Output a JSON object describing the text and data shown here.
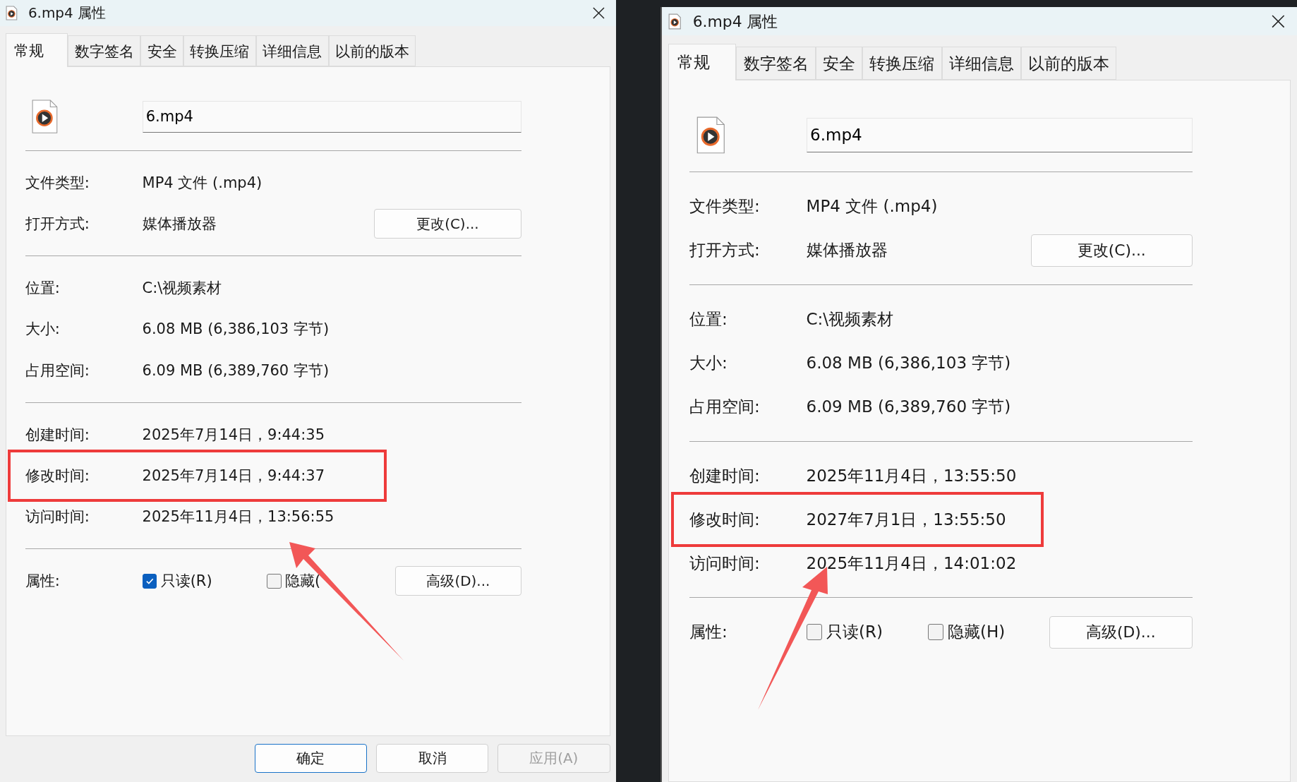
{
  "dialogs": [
    {
      "title": "6.mp4 属性",
      "tabs": [
        {
          "label": "常规",
          "selected": true
        },
        {
          "label": "数字签名",
          "selected": false
        },
        {
          "label": "安全",
          "selected": false
        },
        {
          "label": "转换压缩",
          "selected": false
        },
        {
          "label": "详细信息",
          "selected": false
        },
        {
          "label": "以前的版本",
          "selected": false
        }
      ],
      "filename": "6.mp4",
      "groups": [
        [
          {
            "label": "文件类型:",
            "value": "MP4 文件 (.mp4)",
            "highlighted": false
          },
          {
            "label": "打开方式:",
            "value": "媒体播放器",
            "button": "更改(C)...",
            "highlighted": false
          }
        ],
        [
          {
            "label": "位置:",
            "value": "C:\\视频素材",
            "highlighted": false
          },
          {
            "label": "大小:",
            "value": "6.08 MB (6,386,103 字节)",
            "highlighted": false
          },
          {
            "label": "占用空间:",
            "value": "6.09 MB (6,389,760 字节)",
            "highlighted": false
          }
        ],
        [
          {
            "label": "创建时间:",
            "value": "2025年7月14日，9:44:35",
            "highlighted": false
          },
          {
            "label": "修改时间:",
            "value": "2025年7月14日，9:44:37",
            "highlighted": true
          },
          {
            "label": "访问时间:",
            "value": "2025年11月4日，13:56:55",
            "highlighted": false
          }
        ]
      ],
      "attributes": {
        "label": "属性:",
        "checkboxes": [
          {
            "label": "只读(R)",
            "checked": true
          },
          {
            "label": "隐藏(",
            "checked": false
          }
        ],
        "button": "高级(D)..."
      },
      "footer": [
        {
          "label": "确定",
          "disabled": false
        },
        {
          "label": "取消",
          "disabled": false
        },
        {
          "label": "应用(A)",
          "disabled": true
        }
      ]
    },
    {
      "title": "6.mp4 属性",
      "tabs": [
        {
          "label": "常规",
          "selected": true
        },
        {
          "label": "数字签名",
          "selected": false
        },
        {
          "label": "安全",
          "selected": false
        },
        {
          "label": "转换压缩",
          "selected": false
        },
        {
          "label": "详细信息",
          "selected": false
        },
        {
          "label": "以前的版本",
          "selected": false
        }
      ],
      "filename": "6.mp4",
      "groups": [
        [
          {
            "label": "文件类型:",
            "value": "MP4 文件 (.mp4)",
            "highlighted": false
          },
          {
            "label": "打开方式:",
            "value": "媒体播放器",
            "button": "更改(C)...",
            "highlighted": false
          }
        ],
        [
          {
            "label": "位置:",
            "value": "C:\\视频素材",
            "highlighted": false
          },
          {
            "label": "大小:",
            "value": "6.08 MB (6,386,103 字节)",
            "highlighted": false
          },
          {
            "label": "占用空间:",
            "value": "6.09 MB (6,389,760 字节)",
            "highlighted": false
          }
        ],
        [
          {
            "label": "创建时间:",
            "value": "2025年11月4日，13:55:50",
            "highlighted": false
          },
          {
            "label": "修改时间:",
            "value": "2027年7月1日，13:55:50",
            "highlighted": true
          },
          {
            "label": "访问时间:",
            "value": "2025年11月4日，14:01:02",
            "highlighted": false
          }
        ]
      ],
      "attributes": {
        "label": "属性:",
        "checkboxes": [
          {
            "label": "只读(R)",
            "checked": false
          },
          {
            "label": "隐藏(H)",
            "checked": false
          }
        ],
        "button": "高级(D)..."
      }
    }
  ]
}
